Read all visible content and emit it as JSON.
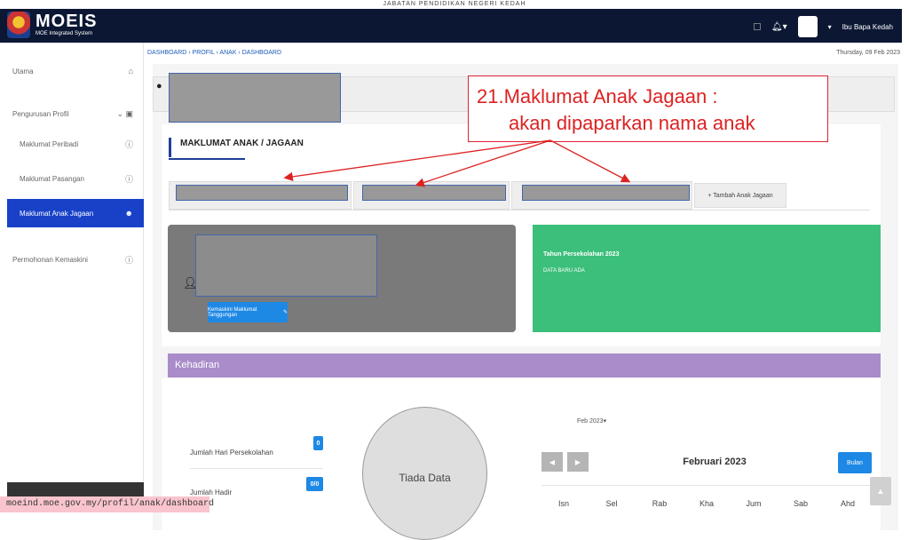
{
  "top_caption": "JABATAN PENDIDIKAN NEGERI KEDAH",
  "navbar": {
    "brand_logo": "MOEIS",
    "brand_subtitle": "MOE Integrated System",
    "user_name": "Ibu Bapa Kedah"
  },
  "sidebar": {
    "items": [
      {
        "label": "Utama",
        "icon": "home-icon",
        "glyph": "⌂"
      },
      {
        "label": "Pengurusan Profil",
        "icon": "profile-icon",
        "glyph": "▣"
      },
      {
        "label": "Maklumat Peribadi",
        "icon": "info-icon",
        "glyph": "ⓘ"
      },
      {
        "label": "Maklumat Pasangan",
        "icon": "info-icon",
        "glyph": "ⓘ"
      },
      {
        "label": "Maklumat Anak Jagaan",
        "icon": "child-icon",
        "glyph": "☻"
      },
      {
        "label": "Permohonan Kemaskini",
        "icon": "info-icon",
        "glyph": "ⓘ"
      }
    ]
  },
  "breadcrumb": "DASHBOARD › PROFIL › ANAK › DASHBOARD",
  "date": "Thursday, 09 Feb 2023",
  "section_title": "MAKLUMAT ANAK / JAGAAN",
  "add_child_label": "+ Tambah Anak Jagaan",
  "edit_button_label": "Kemaskini Maklumat Tanggungan",
  "green_card": {
    "title": "Tahun Persekolahan 2023",
    "subtitle": "DATA BARU ADA"
  },
  "attendance": {
    "title": "Kehadiran",
    "stats": [
      {
        "label": "Jumlah Hari Persekolahan",
        "value": "0"
      },
      {
        "label": "Jumlah Hadir",
        "value": "0/0"
      }
    ],
    "pie_label": "Tiada Data"
  },
  "calendar": {
    "month_select": "Feb 2023",
    "title": "Februari 2023",
    "today_label": "Bulan",
    "weekdays": [
      "Isn",
      "Sel",
      "Rab",
      "Kha",
      "Jum",
      "Sab",
      "Ahd"
    ]
  },
  "annotation": {
    "line1": "21.Maklumat Anak Jagaan :",
    "line2": "akan dipaparkan nama anak"
  },
  "url_bar": "moeind.moe.gov.my/profil/anak/dashboard",
  "colors": {
    "navbar": "#0b1733",
    "sidebar_active": "#1841c8",
    "green_card": "#3cbf7a",
    "attendance_bar": "#a98cc9",
    "annotation": "#dd2222",
    "button_blue": "#1e88e5"
  }
}
